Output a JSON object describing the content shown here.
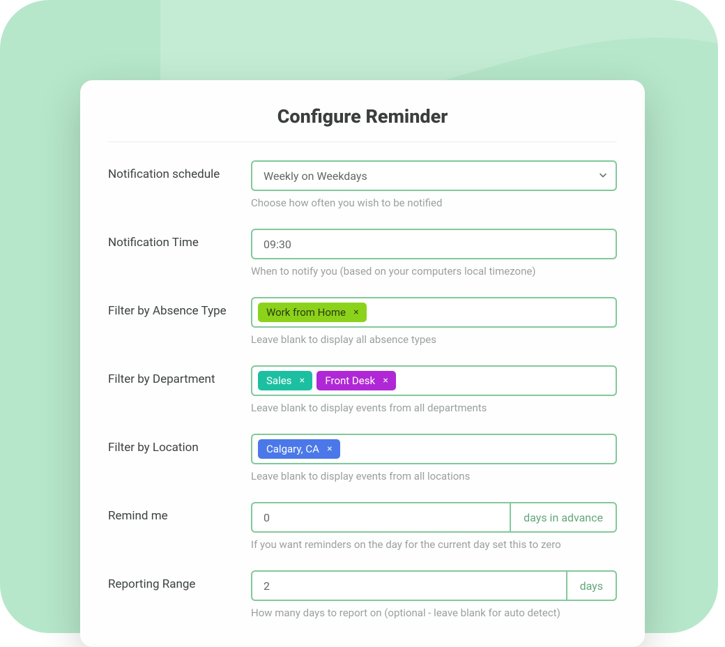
{
  "title": "Configure Reminder",
  "fields": {
    "schedule": {
      "label": "Notification schedule",
      "value": "Weekly on Weekdays",
      "hint": "Choose how often you wish to be notified"
    },
    "time": {
      "label": "Notification Time",
      "value": "09:30",
      "hint": "When to notify you (based on your computers local timezone)"
    },
    "absence": {
      "label": "Filter by Absence Type",
      "tags": [
        {
          "text": "Work from Home",
          "color": "wfh"
        }
      ],
      "hint": "Leave blank to display all absence types"
    },
    "department": {
      "label": "Filter by Department",
      "tags": [
        {
          "text": "Sales",
          "color": "sales"
        },
        {
          "text": "Front Desk",
          "color": "front"
        }
      ],
      "hint": "Leave blank to display events from all departments"
    },
    "location": {
      "label": "Filter by Location",
      "tags": [
        {
          "text": "Calgary, CA",
          "color": "calgary"
        }
      ],
      "hint": "Leave blank to display events from all locations"
    },
    "remind": {
      "label": "Remind me",
      "value": "0",
      "addon": "days in advance",
      "hint": "If you want reminders on the day for the current day set this to zero"
    },
    "range": {
      "label": "Reporting Range",
      "value": "2",
      "addon": "days",
      "hint": "How many days to report on (optional - leave blank for auto detect)"
    }
  }
}
